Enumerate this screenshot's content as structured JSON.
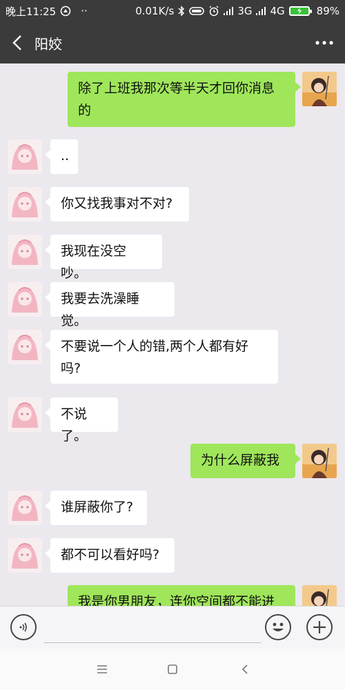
{
  "status_bar": {
    "time": "晚上11:25",
    "dots": "··",
    "net_speed": "0.01K/s",
    "net_type_1": "3G",
    "net_type_2": "4G",
    "battery": "89%"
  },
  "header": {
    "title": "阳姣",
    "back_icon": "chevron-left-icon",
    "more_icon": "more-dots-icon"
  },
  "messages": [
    {
      "from": "me",
      "text": "除了上班我那次等半天才回你消息的"
    },
    {
      "from": "them",
      "text": ".."
    },
    {
      "from": "them",
      "text": "你又找我事对不对?"
    },
    {
      "from": "them",
      "text": "我现在没空吵。"
    },
    {
      "from": "them",
      "text": "我要去洗澡睡觉。"
    },
    {
      "from": "them",
      "text": "不要说一个人的错,两个人都有好吗?"
    },
    {
      "from": "them",
      "text": "不说了。"
    },
    {
      "from": "me",
      "text": "为什么屏蔽我"
    },
    {
      "from": "them",
      "text": "谁屏蔽你了?"
    },
    {
      "from": "them",
      "text": "都不可以看好吗?"
    },
    {
      "from": "me",
      "text": "我是你男朋友，连你空间都不能进"
    }
  ],
  "input_bar": {
    "input_value": "",
    "voice_icon": "voice-icon",
    "emoji_icon": "emoji-icon",
    "plus_icon": "plus-icon"
  },
  "nav_bar": {
    "menu_icon": "menu-icon",
    "home_icon": "home-square-icon",
    "back_icon": "back-triangle-icon"
  },
  "colors": {
    "header_bg": "#3b3b3b",
    "chat_bg": "#ebe8ee",
    "my_bubble": "#9fe65b",
    "their_bubble": "#ffffff",
    "battery_fill": "#39c23a"
  }
}
